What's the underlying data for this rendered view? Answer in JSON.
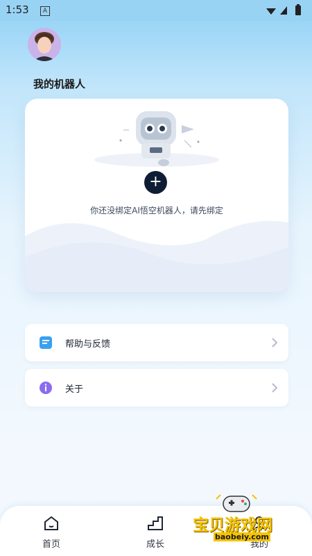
{
  "status_bar": {
    "time": "1:53",
    "indicator_letter": "A"
  },
  "profile": {
    "avatar_icon": "avatar-icon"
  },
  "robots_section": {
    "title": "我的机器人",
    "empty_hint": "你还没绑定AI悟空机器人，请先绑定",
    "add_label": "+"
  },
  "menu": {
    "items": [
      {
        "label": "帮助与反馈",
        "icon": "feedback-icon"
      },
      {
        "label": "关于",
        "icon": "info-icon"
      }
    ]
  },
  "bottom_nav": {
    "items": [
      {
        "label": "首页",
        "icon": "home-icon"
      },
      {
        "label": "成长",
        "icon": "growth-icon"
      },
      {
        "label": "我的",
        "icon": "profile-icon"
      }
    ]
  },
  "watermark": {
    "text": "宝贝游戏网",
    "url": "baobeiy.com"
  },
  "colors": {
    "accent": "#0f1d34",
    "feedback_icon": "#3aa0f0",
    "info_icon": "#8b6cf0",
    "watermark": "#f5c400"
  }
}
